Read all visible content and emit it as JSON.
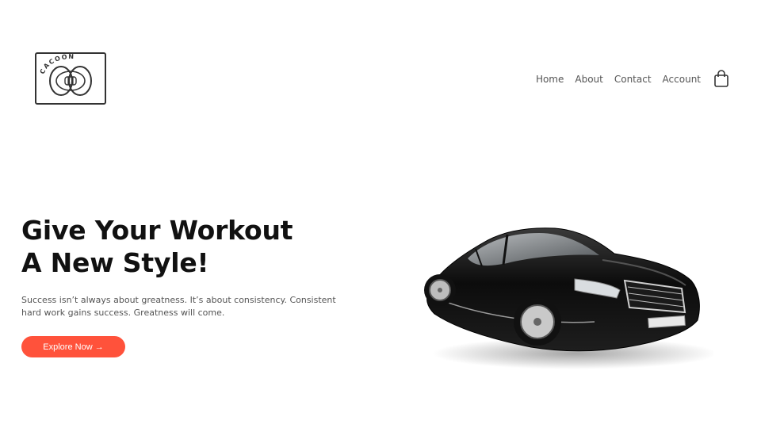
{
  "header": {
    "logo": {
      "icon": "cocoon-logo",
      "text": "CACOON"
    },
    "nav": [
      {
        "label": "Home"
      },
      {
        "label": "About"
      },
      {
        "label": "Contact"
      },
      {
        "label": "Account"
      }
    ],
    "cart_icon": "shopping-bag-icon"
  },
  "hero": {
    "title_line1": "Give Your Workout",
    "title_line2": "A New Style!",
    "desc_line1": "Success isn’t always about greatness. It’s about consistency. Consistent",
    "desc_line2": "hard work gains success. Greatness will come.",
    "cta_label": "Explore Now →",
    "image": "black-sedan-car"
  },
  "colors": {
    "accent": "#ff523b",
    "heading": "#111111",
    "text": "#555555",
    "background": "#ffffff"
  }
}
